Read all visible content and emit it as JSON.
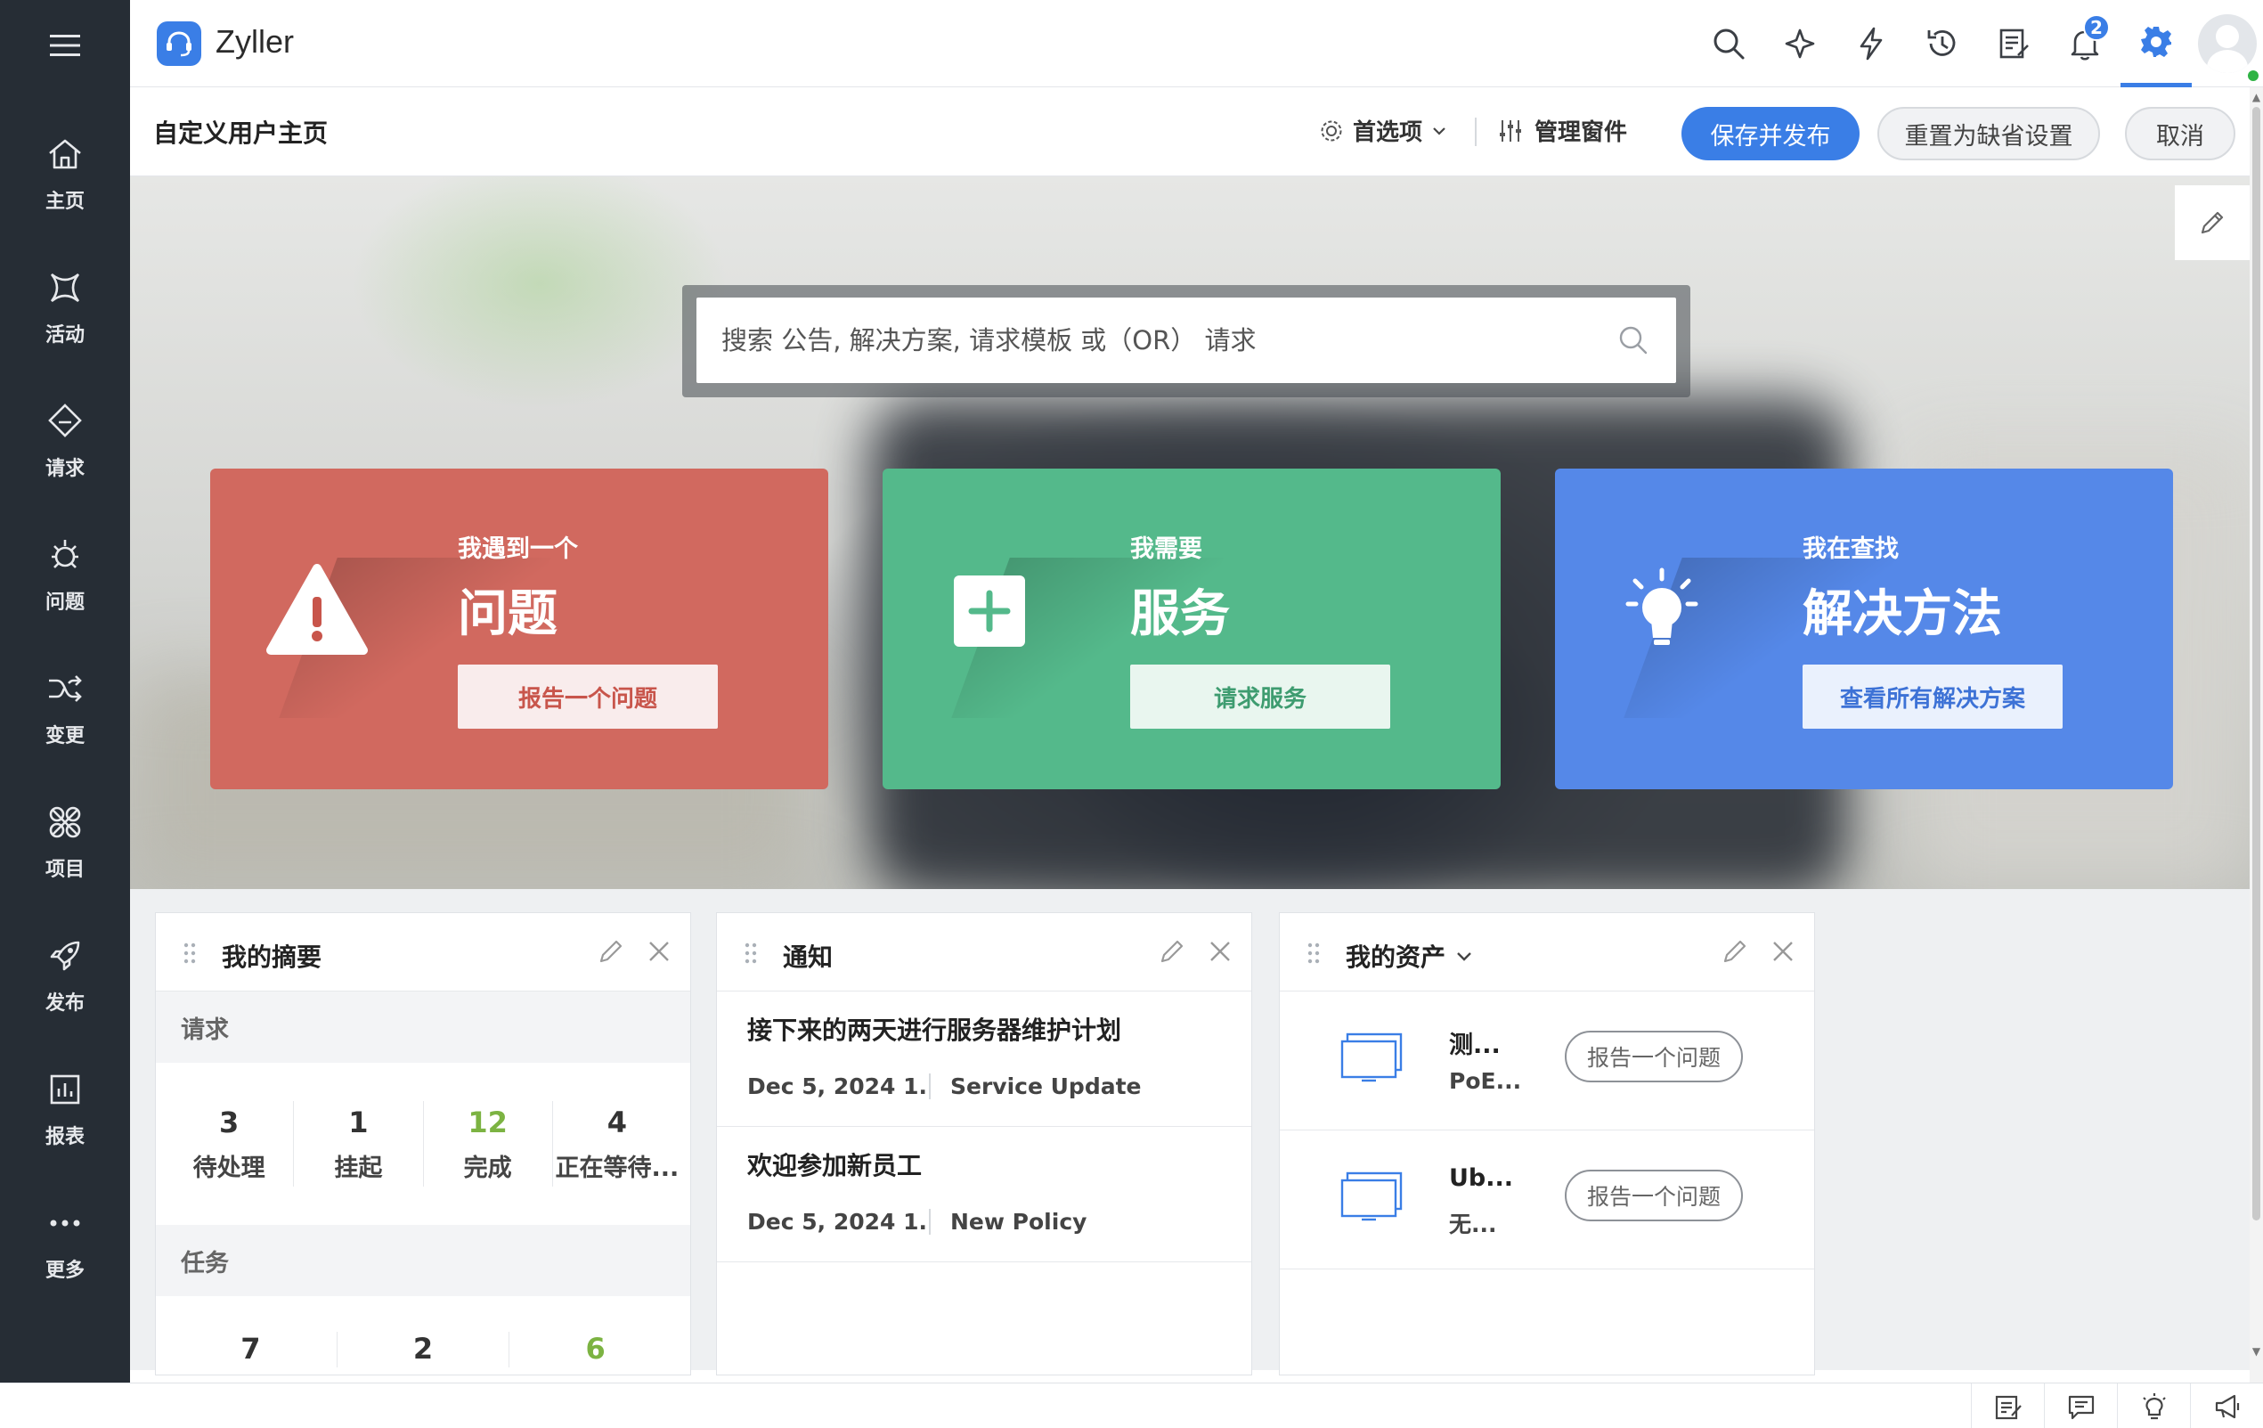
{
  "app": {
    "name": "Zyller"
  },
  "sidebar": {
    "items": [
      {
        "label": "主页",
        "icon": "home-icon"
      },
      {
        "label": "活动",
        "icon": "activity-icon"
      },
      {
        "label": "请求",
        "icon": "request-tag-icon"
      },
      {
        "label": "问题",
        "icon": "problem-bug-icon"
      },
      {
        "label": "变更",
        "icon": "change-shuffle-icon"
      },
      {
        "label": "项目",
        "icon": "project-icon"
      },
      {
        "label": "发布",
        "icon": "release-rocket-icon"
      },
      {
        "label": "报表",
        "icon": "report-chart-icon"
      },
      {
        "label": "更多",
        "icon": "more-dots-icon"
      }
    ]
  },
  "header": {
    "notification_count": "2",
    "icons": [
      "search-icon",
      "sparkle-icon",
      "lightning-icon",
      "history-icon",
      "notes-icon",
      "bell-icon",
      "gear-icon",
      "avatar"
    ]
  },
  "subheader": {
    "title": "自定义用户主页",
    "preferences": "首选项",
    "manage_widgets": "管理窗件",
    "publish": "保存并发布",
    "reset": "重置为缺省设置",
    "cancel": "取消"
  },
  "hero": {
    "search_placeholder": "搜索 公告, 解决方案, 请求模板 或（OR） 请求",
    "cards": [
      {
        "kicker": "我遇到一个",
        "headline": "问题",
        "cta": "报告一个问题",
        "color": "#d1695f"
      },
      {
        "kicker": "我需要",
        "headline": "服务",
        "cta": "请求服务",
        "color": "#54b98b"
      },
      {
        "kicker": "我在查找",
        "headline": "解决方法",
        "cta": "查看所有解决方案",
        "color": "#5588e8"
      }
    ]
  },
  "widgets": {
    "summary": {
      "title": "我的摘要",
      "requests_label": "请求",
      "requests": [
        {
          "num": "3",
          "label": "待处理"
        },
        {
          "num": "1",
          "label": "挂起"
        },
        {
          "num": "12",
          "label": "完成"
        },
        {
          "num": "4",
          "label": "正在等待..."
        }
      ],
      "tasks_label": "任务",
      "tasks": [
        {
          "num": "7"
        },
        {
          "num": "2"
        },
        {
          "num": "6"
        }
      ]
    },
    "notifications": {
      "title": "通知",
      "items": [
        {
          "title": "接下来的两天进行服务器维护计划",
          "date": "Dec 5, 2024 1...",
          "category": "Service Update"
        },
        {
          "title": "欢迎参加新员工",
          "date": "Dec 5, 2024 1...",
          "category": "New Policy"
        }
      ]
    },
    "assets": {
      "title": "我的资产",
      "items": [
        {
          "name": "测...",
          "sub": "PoE...",
          "action": "报告一个问题"
        },
        {
          "name": "Ub...",
          "sub": "无...",
          "action": "报告一个问题"
        }
      ]
    }
  },
  "accent_color": "#3a7ee6"
}
